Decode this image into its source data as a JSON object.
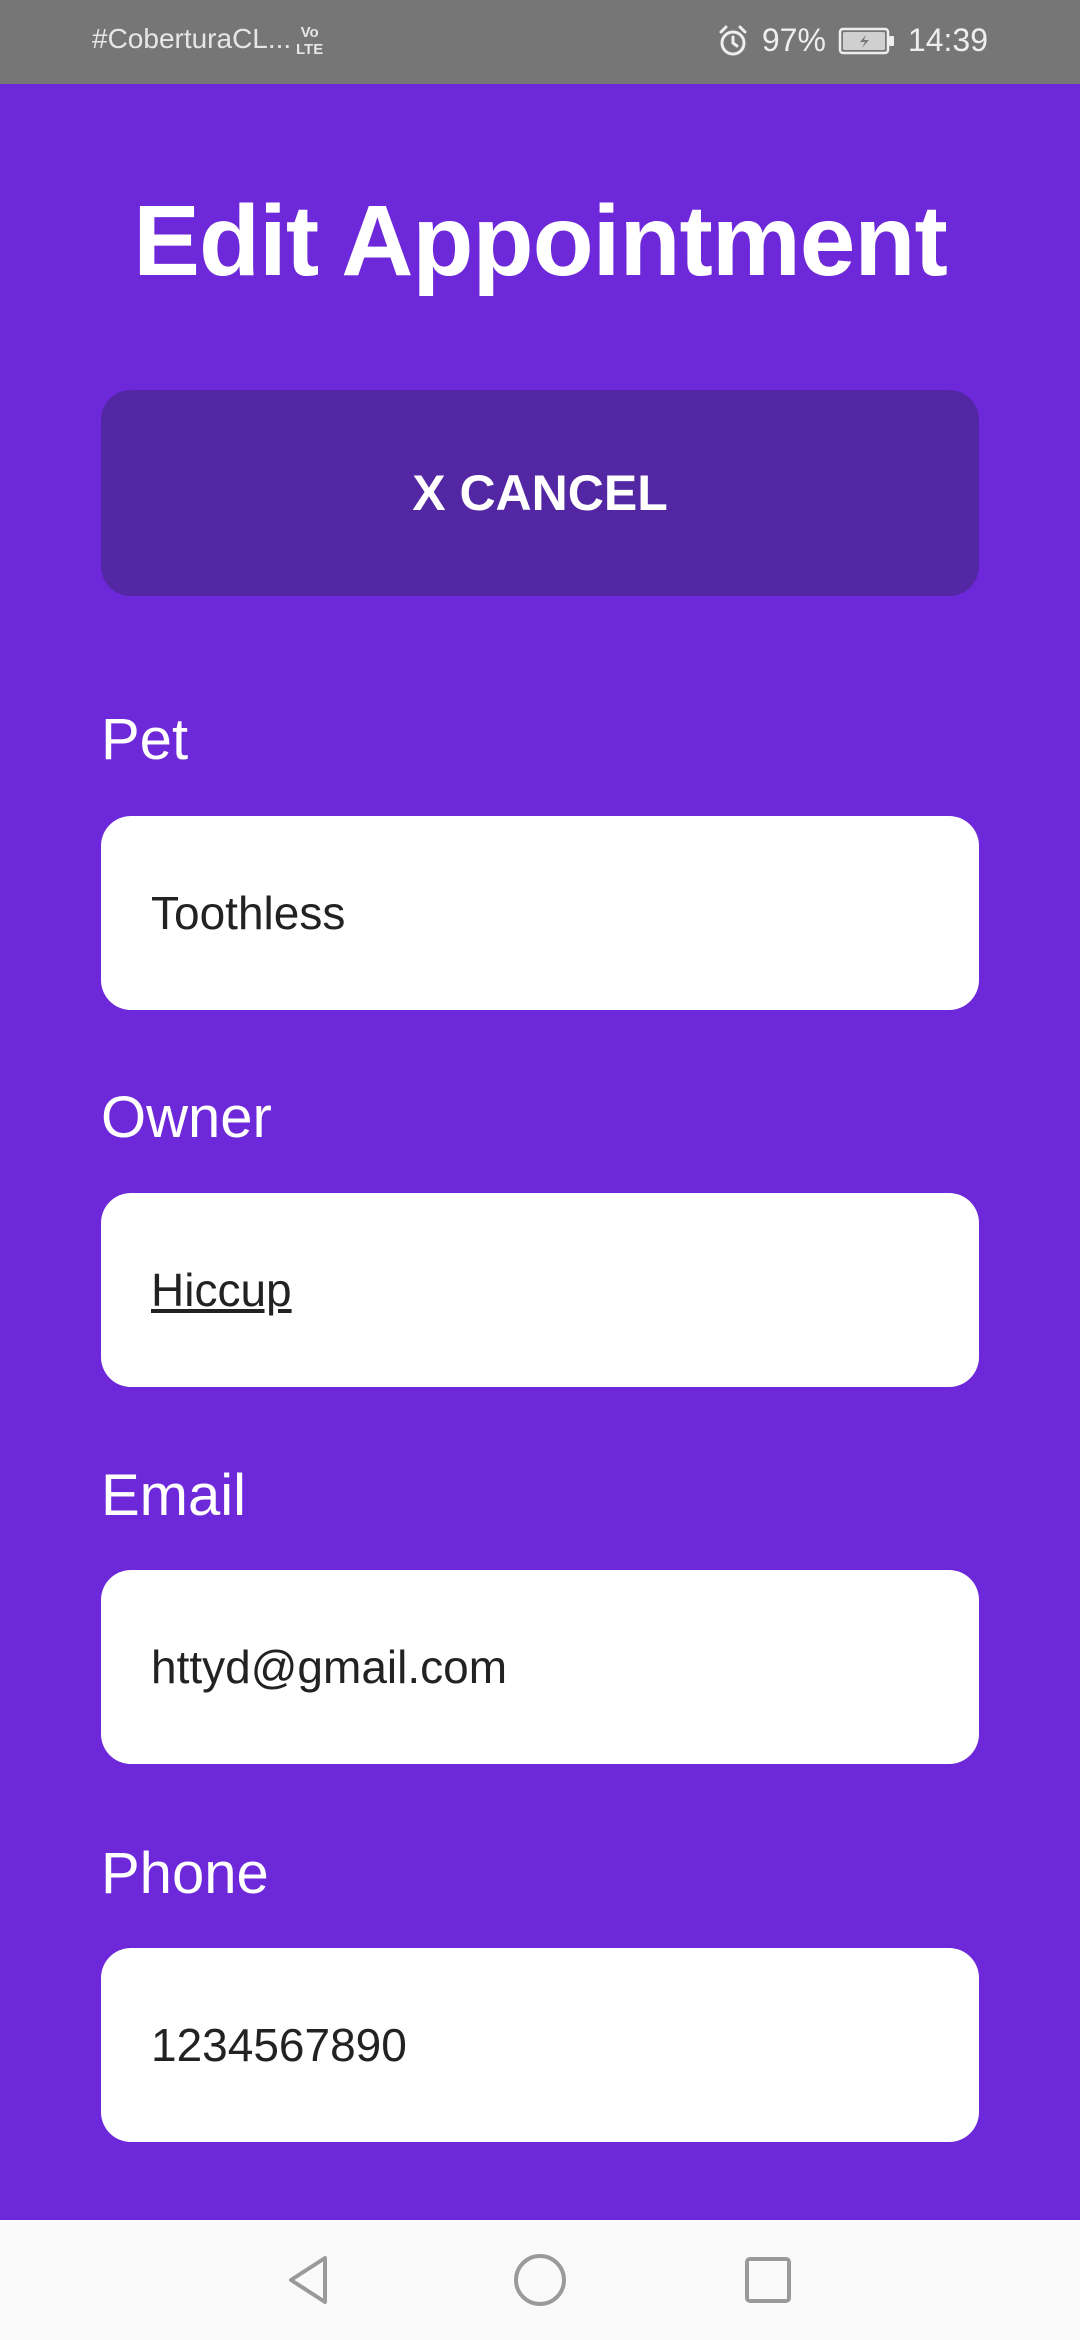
{
  "status_bar": {
    "carrier": "#CoberturaCL...",
    "volte_line1": "Vo",
    "volte_line2": "LTE",
    "battery_percent": "97%",
    "time": "14:39",
    "icons": [
      "alarm-icon",
      "battery-icon"
    ]
  },
  "page": {
    "title": "Edit Appointment",
    "cancel_label": "X CANCEL"
  },
  "form": {
    "pet": {
      "label": "Pet",
      "value": "Toothless"
    },
    "owner": {
      "label": "Owner",
      "value": "Hiccup"
    },
    "email": {
      "label": "Email",
      "value": "httyd@gmail.com"
    },
    "phone": {
      "label": "Phone",
      "value": "1234567890"
    }
  },
  "nav_bar": {
    "icons": [
      "back-triangle-icon",
      "home-circle-icon",
      "recents-square-icon"
    ]
  },
  "colors": {
    "background": "#6d28d9",
    "cancel_button": "#5327a4",
    "field_background": "#ffffff",
    "status_bar": "#767676"
  }
}
